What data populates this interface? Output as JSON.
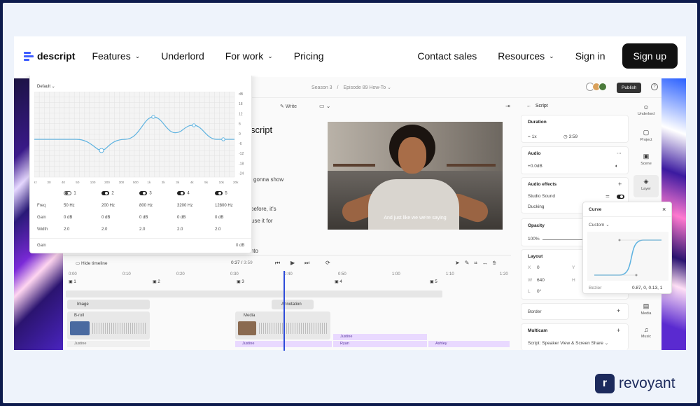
{
  "nav": {
    "logo": "descript",
    "items": [
      {
        "label": "Features",
        "chevron": true
      },
      {
        "label": "Underlord",
        "chevron": false
      },
      {
        "label": "For work",
        "chevron": true
      },
      {
        "label": "Pricing",
        "chevron": false
      }
    ],
    "right": [
      {
        "label": "Contact sales",
        "chevron": false
      },
      {
        "label": "Resources",
        "chevron": true
      },
      {
        "label": "Sign in",
        "chevron": false
      }
    ],
    "signup": "Sign up"
  },
  "app": {
    "breadcrumb_season": "Season 3",
    "breadcrumb_sep": "/",
    "breadcrumb_episode": "Episode 89 How-To",
    "publish": "Publish",
    "write": "Write",
    "script_title": "script",
    "script_lines": [
      "gonna show",
      "before, it's",
      "ble use it for",
      "into"
    ],
    "caption": "And just like we we're saying"
  },
  "props": {
    "header": "Script",
    "duration_title": "Duration",
    "duration_speed": "1x",
    "duration_time": "3:59",
    "audio_title": "Audio",
    "audio_gain": "+0.0dB",
    "effects_title": "Audio effects",
    "effect_1": "Studio Sound",
    "effect_2": "Ducking",
    "opacity_title": "Opacity",
    "opacity_value": "100%",
    "layout_title": "Layout",
    "x_label": "X",
    "x_value": "0",
    "y_label": "Y",
    "w_label": "W",
    "w_value": "640",
    "h_label": "H",
    "r_label": "L",
    "r_value": "0°",
    "border_title": "Border",
    "multicam_title": "Multicam",
    "multicam_value": "Script: Speaker View & Screen Share"
  },
  "rail": [
    "Underlord",
    "Project",
    "Scene",
    "Layer",
    "Media",
    "Music"
  ],
  "curve": {
    "title": "Curve",
    "preset": "Custom",
    "label": "Bezier",
    "value": "0.87, 0, 0.13, 1"
  },
  "timeline": {
    "hide": "Hide timeline",
    "time_current": "0:37",
    "time_sep": "/",
    "time_total": "3:59",
    "ruler": [
      "0:00",
      "0:10",
      "0:20",
      "0:30",
      "0:40",
      "0:50",
      "1:00",
      "1:10",
      "1:20"
    ],
    "segments": [
      "1",
      "2",
      "3",
      "4",
      "5"
    ],
    "clip_image": "Image",
    "clip_broll": "B-roll",
    "clip_media": "Media",
    "clip_annotation": "Annotation",
    "speakers": [
      "Justine",
      "Justine",
      "Justine",
      "Ryan",
      "Ashley"
    ]
  },
  "eq": {
    "preset": "Default",
    "db_ticks": [
      "dB",
      "18",
      "12",
      "6",
      "0",
      "-6",
      "-12",
      "-18",
      "-24"
    ],
    "freq_ticks": [
      "Hz",
      "30",
      "40",
      "50",
      "100",
      "200",
      "300",
      "500",
      "1k",
      "2k",
      "3k",
      "4k",
      "5k",
      "10k",
      "20k"
    ],
    "bands": [
      {
        "num": "1",
        "on": false,
        "freq": "50 Hz",
        "gain": "0 dB",
        "width": "2.0"
      },
      {
        "num": "2",
        "on": true,
        "freq": "200 Hz",
        "gain": "0 dB",
        "width": "2.0"
      },
      {
        "num": "3",
        "on": true,
        "freq": "800 Hz",
        "gain": "0 dB",
        "width": "2.0"
      },
      {
        "num": "4",
        "on": true,
        "freq": "3200 Hz",
        "gain": "0 dB",
        "width": "2.0"
      },
      {
        "num": "5",
        "on": true,
        "freq": "12800 Hz",
        "gain": "0 dB",
        "width": "2.0"
      }
    ],
    "row_freq": "Freq",
    "row_gain": "Gain",
    "row_width": "Width",
    "master_label": "Gain",
    "master_value": "0 dB"
  },
  "brand": {
    "mark": "r",
    "name": "revoyant"
  },
  "colors": {
    "accent": "#3d5cff",
    "playhead": "#2d4bd9",
    "brand": "#1c2a5c",
    "curve": "#5fb3e0"
  }
}
